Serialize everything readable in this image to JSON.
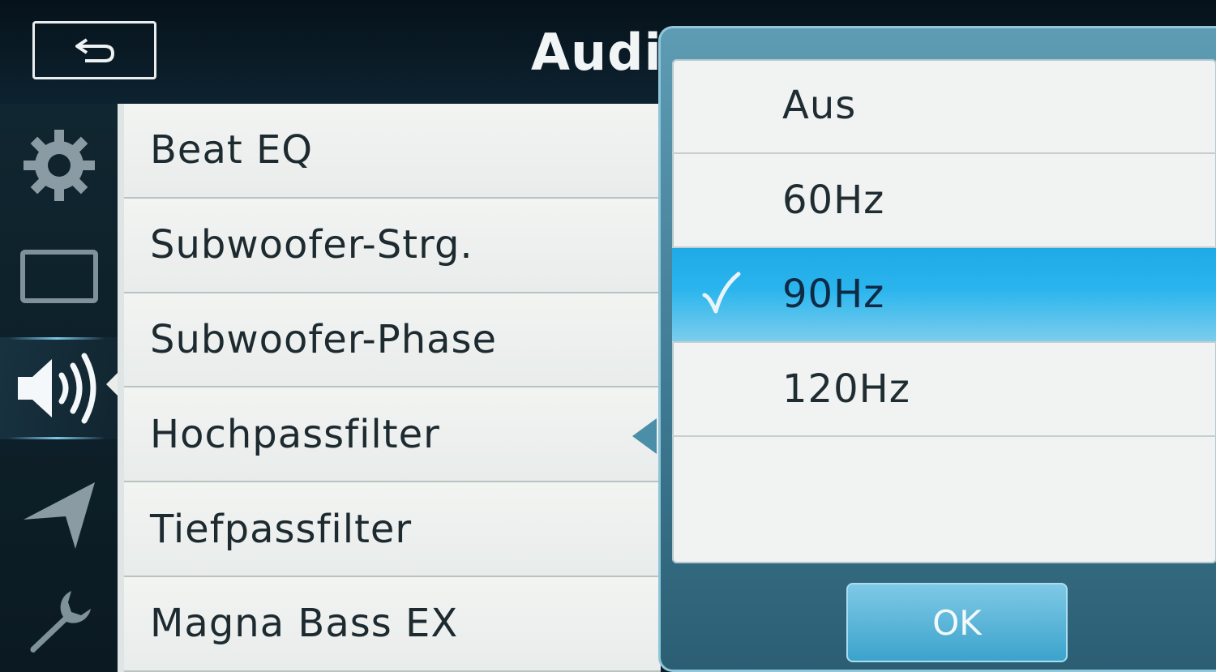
{
  "header": {
    "title": "Audi"
  },
  "sidebar": {
    "items": [
      {
        "icon": "gear-icon"
      },
      {
        "icon": "screen-icon"
      },
      {
        "icon": "speaker-icon",
        "active": true
      },
      {
        "icon": "navigation-arrow-icon"
      },
      {
        "icon": "wrench-icon"
      }
    ]
  },
  "menu": {
    "items": [
      {
        "label": "Beat EQ"
      },
      {
        "label": "Subwoofer-Strg."
      },
      {
        "label": "Subwoofer-Phase"
      },
      {
        "label": "Hochpassfilter"
      },
      {
        "label": "Tiefpassfilter"
      },
      {
        "label": "Magna Bass EX"
      }
    ]
  },
  "popup": {
    "options": [
      {
        "label": "Aus"
      },
      {
        "label": "60Hz"
      },
      {
        "label": "90Hz",
        "selected": true
      },
      {
        "label": "120Hz"
      }
    ],
    "ok_label": "OK"
  },
  "colors": {
    "selected": "#2bb5ee",
    "accent": "#4a8ea8"
  }
}
